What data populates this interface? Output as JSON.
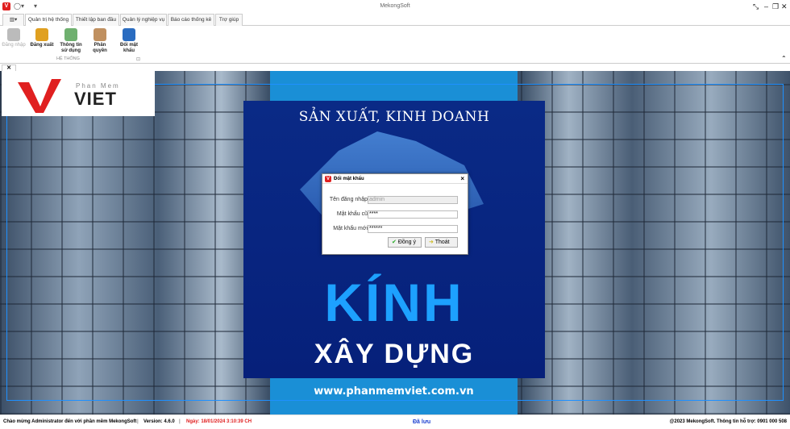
{
  "app": {
    "title": "MekongSoft",
    "logo_letter": "V"
  },
  "tabs": [
    "Quản trị hệ thống",
    "Thiết lập ban đầu",
    "Quản lý nghiệp vụ",
    "Báo cáo thống kê",
    "Trợ giúp"
  ],
  "ribbon": {
    "buttons": [
      "Đăng nhập",
      "Đăng xuất",
      "Thông tin sử dụng",
      "Phân quyền",
      "Đổi mật khẩu"
    ],
    "group": "HỆ THỐNG"
  },
  "brand": {
    "small": "Phan Mem",
    "big": "VIET"
  },
  "poster": {
    "line1": "SẢN XUẤT, KINH DOANH",
    "line2": "KÍNH",
    "line3": "XÂY DỰNG",
    "url": "www.phanmemviet.com.vn"
  },
  "dialog": {
    "title": "Đổi mật khẩu",
    "username_label": "Tên đăng nhập",
    "username": "admin",
    "old_label": "Mật khẩu cũ",
    "old_value": "****",
    "new_label": "Mật khẩu mới",
    "new_value": "******",
    "ok": "Đồng ý",
    "exit": "Thoát"
  },
  "status": {
    "welcome": "Chào mừng Administrator đến với phần mềm MekongSoft",
    "version": "Version: 4.6.0",
    "date": "Ngày: 18/01/2024 3:10:39 CH",
    "saved": "Đã lưu",
    "copyright": "@2023 MekongSoft. Thông tin hỗ trợ: 0901 000 508"
  },
  "colors": {
    "accent": "#e02020",
    "poster": "#0a2a86",
    "band": "#1a8fd6"
  }
}
